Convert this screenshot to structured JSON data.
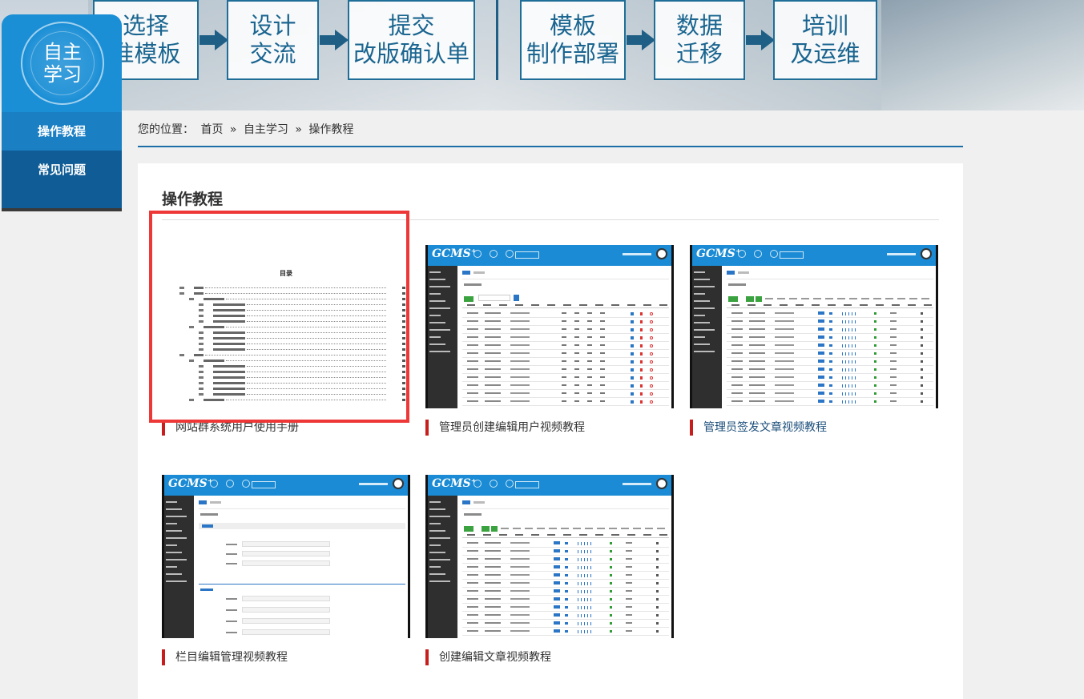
{
  "banner": {
    "steps": [
      {
        "line1": "选择",
        "line2": "准模板"
      },
      {
        "line1": "设计",
        "line2": "交流"
      },
      {
        "line1": "提交",
        "line2": "改版确认单"
      },
      {
        "line1": "模板",
        "line2": "制作部署"
      },
      {
        "line1": "数据",
        "line2": "迁移"
      },
      {
        "line1": "培训",
        "line2": "及运维"
      }
    ]
  },
  "sidebar": {
    "title": "自主学习",
    "items": [
      {
        "label": "操作教程",
        "active": true
      },
      {
        "label": "常见问题",
        "active": false
      }
    ]
  },
  "breadcrumb": {
    "prefix": "您的位置：",
    "home": "首页",
    "sep1": "»",
    "section": "自主学习",
    "sep2": "»",
    "current": "操作教程"
  },
  "main": {
    "title": "操作教程",
    "cards": [
      {
        "label": "网站群系统用户使用手册",
        "thumb": "document-toc"
      },
      {
        "label": "管理员创建编辑用户视频教程",
        "thumb": "cms-user-list"
      },
      {
        "label": "管理员签发文章视频教程",
        "thumb": "cms-article-list"
      },
      {
        "label": "栏目编辑管理视频教程",
        "thumb": "cms-column-form"
      },
      {
        "label": "创建编辑文章视频教程",
        "thumb": "cms-article-list"
      }
    ],
    "doc_thumb_title": "目录",
    "cms_logo": "GCMS⁺"
  },
  "colors": {
    "accent": "#1b8fd6",
    "sidebar_dark": "#0f5c96",
    "label_marker": "#c81d1d",
    "highlight_frame": "#ee3737"
  }
}
